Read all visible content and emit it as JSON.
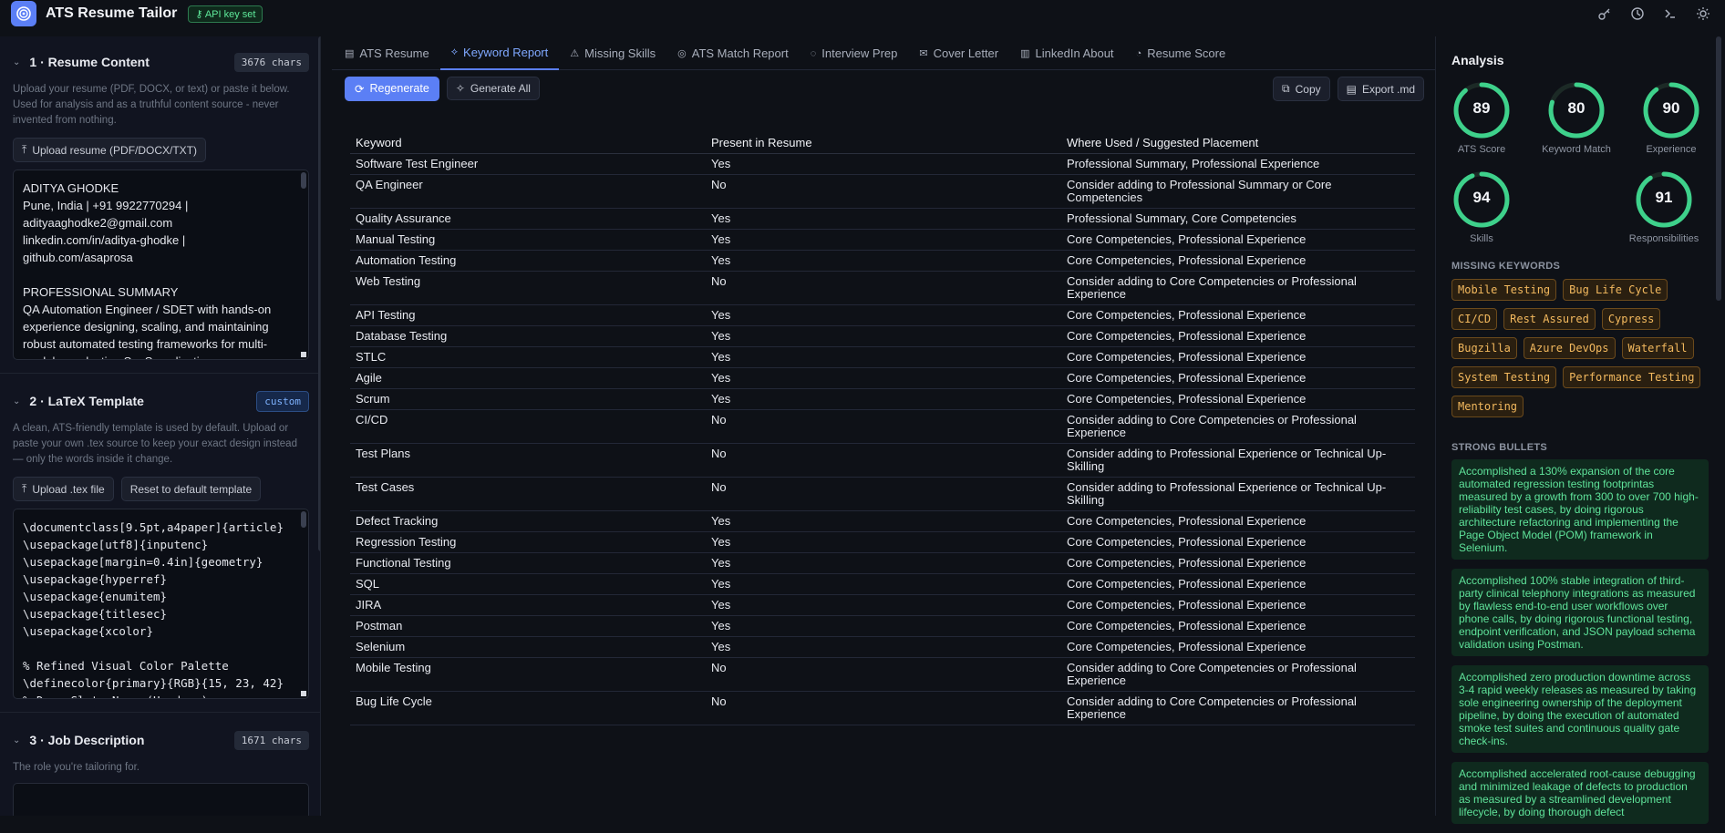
{
  "app": {
    "title": "ATS Resume Tailor",
    "api_badge": "API key set"
  },
  "sidebar": {
    "resume": {
      "title": "1 · Resume Content",
      "badge": "3676 chars",
      "description": "Upload your resume (PDF, DOCX, or text) or paste it below. Used for analysis and as a truthful content source - never invented from nothing.",
      "upload_label": "Upload resume (PDF/DOCX/TXT)",
      "lines": [
        "ADITYA GHODKE",
        "Pune, India | +91 9922770294 |",
        "adityaaghodke2@gmail.com",
        "linkedin.com/in/aditya-ghodke |",
        "github.com/asaprosa",
        "",
        "PROFESSIONAL SUMMARY",
        "QA Automation Engineer / SDET with hands-on",
        "experience designing, scaling, and maintaining",
        "robust automated testing frameworks for multi-",
        "module production SaaS applications"
      ]
    },
    "latex": {
      "title": "2 · LaTeX Template",
      "badge": "custom",
      "description": "A clean, ATS-friendly template is used by default. Upload or paste your own .tex source to keep your exact design instead — only the words inside it change.",
      "upload_label": "Upload .tex file",
      "reset_label": "Reset to default template",
      "lines": [
        "\\documentclass[9.5pt,a4paper]{article}",
        "\\usepackage[utf8]{inputenc}",
        "\\usepackage[margin=0.4in]{geometry}",
        "\\usepackage{hyperref}",
        "\\usepackage{enumitem}",
        "\\usepackage{titlesec}",
        "\\usepackage{xcolor}",
        "",
        "% Refined Visual Color Palette",
        "\\definecolor{primary}{RGB}{15, 23, 42}",
        "% Deep Slate Navy (Headers)"
      ]
    },
    "job": {
      "title": "3 · Job Description",
      "badge": "1671 chars",
      "description": "The role you're tailoring for."
    }
  },
  "tabs": [
    {
      "label": "ATS Resume",
      "icon": "file-icon"
    },
    {
      "label": "Keyword Report",
      "icon": "tag-icon"
    },
    {
      "label": "Missing Skills",
      "icon": "warning-icon"
    },
    {
      "label": "ATS Match Report",
      "icon": "target-icon"
    },
    {
      "label": "Interview Prep",
      "icon": "chat-icon"
    },
    {
      "label": "Cover Letter",
      "icon": "mail-icon"
    },
    {
      "label": "LinkedIn About",
      "icon": "linkedin-icon"
    },
    {
      "label": "Resume Score",
      "icon": "gauge-icon"
    }
  ],
  "toolbar": {
    "regenerate": "Regenerate",
    "generate_all": "Generate All",
    "copy": "Copy",
    "export": "Export .md"
  },
  "table": {
    "headers": [
      "Keyword",
      "Present in Resume",
      "Where Used / Suggested Placement"
    ],
    "rows": [
      [
        "Software Test Engineer",
        "Yes",
        "Professional Summary, Professional Experience"
      ],
      [
        "QA Engineer",
        "No",
        "Consider adding to Professional Summary or Core Competencies"
      ],
      [
        "Quality Assurance",
        "Yes",
        "Professional Summary, Core Competencies"
      ],
      [
        "Manual Testing",
        "Yes",
        "Core Competencies, Professional Experience"
      ],
      [
        "Automation Testing",
        "Yes",
        "Core Competencies, Professional Experience"
      ],
      [
        "Web Testing",
        "No",
        "Consider adding to Core Competencies or Professional Experience"
      ],
      [
        "API Testing",
        "Yes",
        "Core Competencies, Professional Experience"
      ],
      [
        "Database Testing",
        "Yes",
        "Core Competencies, Professional Experience"
      ],
      [
        "STLC",
        "Yes",
        "Core Competencies, Professional Experience"
      ],
      [
        "Agile",
        "Yes",
        "Core Competencies, Professional Experience"
      ],
      [
        "Scrum",
        "Yes",
        "Core Competencies, Professional Experience"
      ],
      [
        "CI/CD",
        "No",
        "Consider adding to Core Competencies or Professional Experience"
      ],
      [
        "Test Plans",
        "No",
        "Consider adding to Professional Experience or Technical Up-Skilling"
      ],
      [
        "Test Cases",
        "No",
        "Consider adding to Professional Experience or Technical Up-Skilling"
      ],
      [
        "Defect Tracking",
        "Yes",
        "Core Competencies, Professional Experience"
      ],
      [
        "Regression Testing",
        "Yes",
        "Core Competencies, Professional Experience"
      ],
      [
        "Functional Testing",
        "Yes",
        "Core Competencies, Professional Experience"
      ],
      [
        "SQL",
        "Yes",
        "Core Competencies, Professional Experience"
      ],
      [
        "JIRA",
        "Yes",
        "Core Competencies, Professional Experience"
      ],
      [
        "Postman",
        "Yes",
        "Core Competencies, Professional Experience"
      ],
      [
        "Selenium",
        "Yes",
        "Core Competencies, Professional Experience"
      ],
      [
        "Mobile Testing",
        "No",
        "Consider adding to Core Competencies or Professional Experience"
      ],
      [
        "Bug Life Cycle",
        "No",
        "Consider adding to Core Competencies or Professional Experience"
      ]
    ]
  },
  "analysis": {
    "title": "Analysis",
    "scores": [
      {
        "label": "ATS Score",
        "value": 89
      },
      {
        "label": "Keyword Match",
        "value": 80
      },
      {
        "label": "Experience",
        "value": 90
      },
      {
        "label": "Skills",
        "value": 94
      },
      {
        "label": "Responsibilities",
        "value": 91
      }
    ],
    "missing_title": "MISSING KEYWORDS",
    "missing": [
      "Mobile Testing",
      "Bug Life Cycle",
      "CI/CD",
      "Rest Assured",
      "Cypress",
      "Bugzilla",
      "Azure DevOps",
      "Waterfall",
      "System Testing",
      "Performance Testing",
      "Mentoring"
    ],
    "strong_title": "STRONG BULLETS",
    "bullets": [
      "Accomplished a 130% expansion of the core automated regression testing footprintas measured by a growth from 300 to over 700 high-reliability test cases, by doing rigorous architecture refactoring and implementing the Page Object Model (POM) framework in Selenium.",
      "Accomplished 100% stable integration of third-party clinical telephony integrations as measured by flawless end-to-end user workflows over phone calls, by doing rigorous functional testing, endpoint verification, and JSON payload schema validation using Postman.",
      "Accomplished zero production downtime across 3-4 rapid weekly releases as measured by taking sole engineering ownership of the deployment pipeline, by doing the execution of automated smoke test suites and continuous quality gate check-ins.",
      "Accomplished accelerated root-cause debugging and minimized leakage of defects to production as measured by a streamlined development lifecycle, by doing thorough defect"
    ],
    "gauge_color": "#3ed18b",
    "track_color": "#1c2a26"
  }
}
